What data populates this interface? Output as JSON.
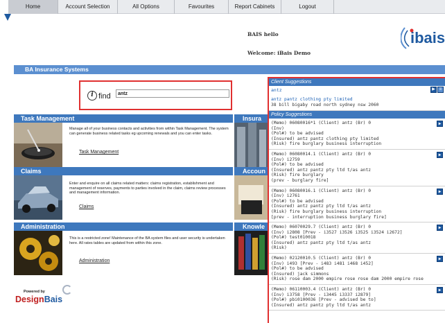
{
  "nav": {
    "tabs": [
      {
        "label": "Home",
        "active": true
      },
      {
        "label": "Account Selection"
      },
      {
        "label": "All Options"
      },
      {
        "label": "Favourites"
      },
      {
        "label": "Report Cabinets"
      },
      {
        "label": "Logout"
      }
    ]
  },
  "header": {
    "greeting": "BAIS hello",
    "welcome_label": "Welcome:",
    "welcome_user": "iBais Demo",
    "logo_text": "ibais"
  },
  "app_title": "BA Insurance Systems",
  "search": {
    "label": "find",
    "value": "antz"
  },
  "sections": [
    {
      "title": "Task Management",
      "description": "Manage all of your business contacts and activities from within Task Management. The system can generate business related tasks eg upcoming renewals and you can enter tasks.",
      "link": "Task Management"
    },
    {
      "title": "Claims",
      "description": "Enter and enquire on all claims related matters: claims registration, establishment and management of reserves, payments to parties involved in the claim, claims review processes and management information.",
      "link": "Claims"
    },
    {
      "title": "Administration",
      "description": "This is a restricted zone! Maintenance of the BA system files and user security is undertaken here. All rates tables are updated from within this zone.",
      "link": "Administration"
    }
  ],
  "right_sections": [
    "Insura",
    "Accoun",
    "Knowle"
  ],
  "footer": {
    "powered_by": "Powered by",
    "brand_design": "Design",
    "brand_bais": "Bais"
  },
  "suggestions": {
    "client_header": "Client Suggestions",
    "client_query": "antz",
    "client_result": {
      "name": "antz pantz clothing pty limited",
      "address": "38 bill bigaby road north sydney nsw 2060"
    },
    "policy_header": "Policy Suggestions",
    "policies": [
      {
        "lines": [
          "(Memo) 06080016*1 (Client) antz (Br) 0",
          "(Inv)",
          "(Pol#) to be advised",
          "(Insured) antz pantz clothing pty limited",
          "(Risk) fire burglary business interruption"
        ]
      },
      {
        "lines": [
          "(Memo) 06080014.1 (Client) antz (Br) 0",
          "(Inv) i2759",
          "(Pol#) to be advised",
          "(Insured) antz pantz pty ltd t/as antz",
          "(Risk) fire burglary",
          "(prev - burglary fire]"
        ]
      },
      {
        "lines": [
          "(Memo) 06080016.1 (Client) antz (Br) 0",
          "(Inv) i2761",
          "(Pol#) to be advised",
          "(Insured) antz pantz pty ltd t/as antz",
          "(Risk) fire burglary business interruption",
          "[prev - interruption business burglary fire]"
        ]
      },
      {
        "lines": [
          "(Memo) 06070029.7 (Client) antz (Br) 0",
          "(Inv) i2808 [Prev - i3527 i3526 i3525 i3524 i2672]",
          "(Pol#) test010018",
          "(Insured) antz pantz pty ltd t/as antz",
          "(Risk)"
        ]
      },
      {
        "lines": [
          "(Memo) 02120010.5 (Client) antz (Br) 0",
          "(Inv) i493 [Prev - i483 i481 i468 i452]",
          "(Pol#) to be advised",
          "(Insured) jack simmons",
          "(Risk) rose dam 2000 empire rose rose dam 2000 empire rose"
        ]
      },
      {
        "lines": [
          "(Memo) 06110003.4 (Client) antz (Br) 0",
          "(Inv) i3758 [Prev - i3445 i3337 i2879]",
          "(Pol#) pbi0100036 [Prev - advised be to]",
          "(Insured) antz pantz pty ltd t/as antz"
        ]
      }
    ]
  }
}
